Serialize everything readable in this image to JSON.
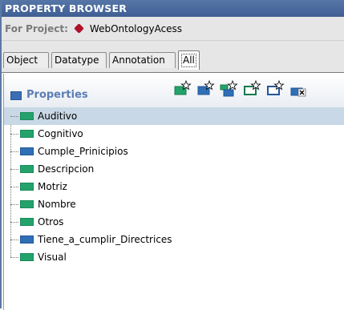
{
  "window": {
    "title": "PROPERTY BROWSER"
  },
  "project": {
    "label": "For Project:",
    "name": "WebOntologyAcess",
    "icon": "project-diamond-icon",
    "icon_color": "#b0102a"
  },
  "tabs": [
    {
      "label": "Object",
      "active": false
    },
    {
      "label": "Datatype",
      "active": false
    },
    {
      "label": "Annotation",
      "active": false
    },
    {
      "label": "All",
      "active": true
    }
  ],
  "panel": {
    "title": "Properties",
    "toolbar": [
      {
        "name": "create-object-property-button",
        "icon": "green-property-star-icon"
      },
      {
        "name": "create-datatype-property-button",
        "icon": "blue-property-star-icon"
      },
      {
        "name": "create-subproperty-button",
        "icon": "subproperty-star-icon"
      },
      {
        "name": "create-annotation-property-button",
        "icon": "green-outline-star-icon"
      },
      {
        "name": "create-property-button",
        "icon": "outline-star-icon"
      },
      {
        "name": "delete-property-button",
        "icon": "delete-property-icon"
      }
    ]
  },
  "properties": [
    {
      "label": "Auditivo",
      "kind": "object",
      "selected": true
    },
    {
      "label": "Cognitivo",
      "kind": "object",
      "selected": false
    },
    {
      "label": "Cumple_Prinicipios",
      "kind": "datatype",
      "selected": false
    },
    {
      "label": "Descripcion",
      "kind": "object",
      "selected": false
    },
    {
      "label": "Motriz",
      "kind": "object",
      "selected": false
    },
    {
      "label": "Nombre",
      "kind": "object",
      "selected": false
    },
    {
      "label": "Otros",
      "kind": "object",
      "selected": false
    },
    {
      "label": "Tiene_a_cumplir_Directrices",
      "kind": "datatype",
      "selected": false
    },
    {
      "label": "Visual",
      "kind": "object",
      "selected": false
    }
  ],
  "colors": {
    "title_bar": "#4a6a9e",
    "selection": "#c9d8e6",
    "object_property": "#23a36b",
    "datatype_property": "#2f6fb6",
    "panel_title": "#5b7db2"
  }
}
